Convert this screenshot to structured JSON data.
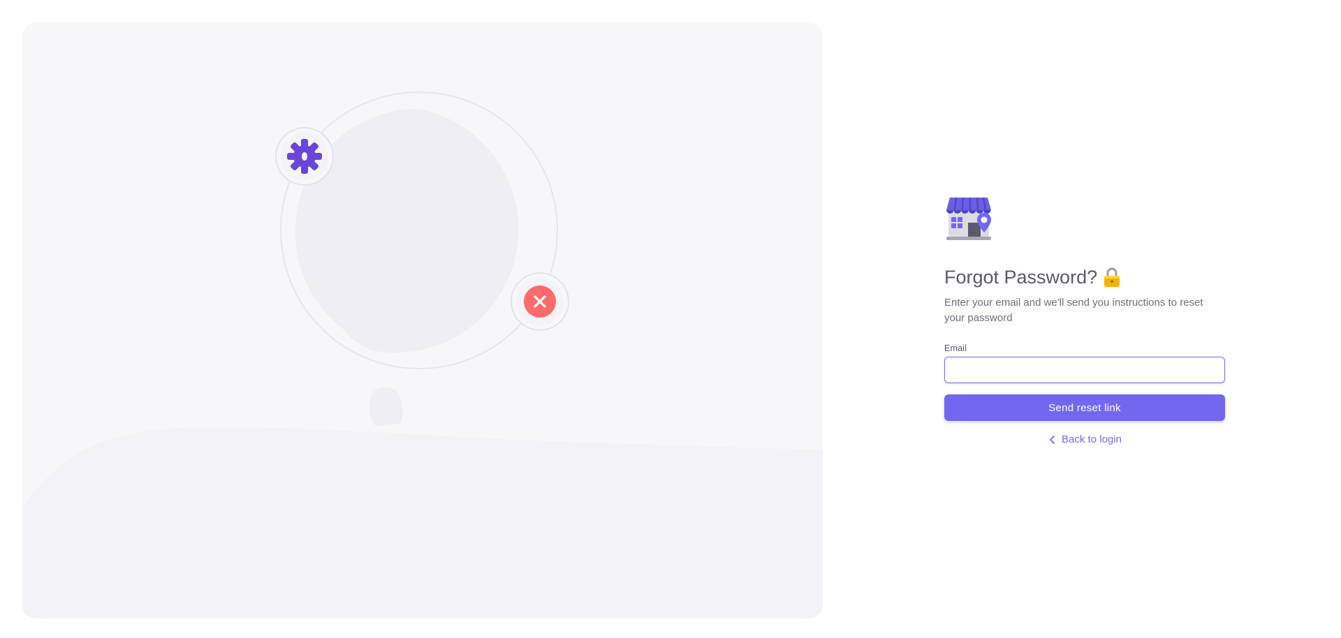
{
  "auth": {
    "title": "Forgot Password?",
    "subtitle": "Enter your email and we'll send you instructions to reset your password",
    "email_label": "Email",
    "email_value": "",
    "email_placeholder": "",
    "submit_label": "Send reset link",
    "back_label": "Back to login"
  },
  "icons": {
    "brand": "store-with-location-pin-icon",
    "title_emoji": "lock-icon",
    "back": "chevron-left-icon",
    "gear": "gear-icon",
    "error": "close-icon"
  },
  "colors": {
    "primary": "#7367f0",
    "text": "#5d596c",
    "muted": "#6f6b7d",
    "panel": "#f7f7f9",
    "error": "#ff6b6b"
  }
}
